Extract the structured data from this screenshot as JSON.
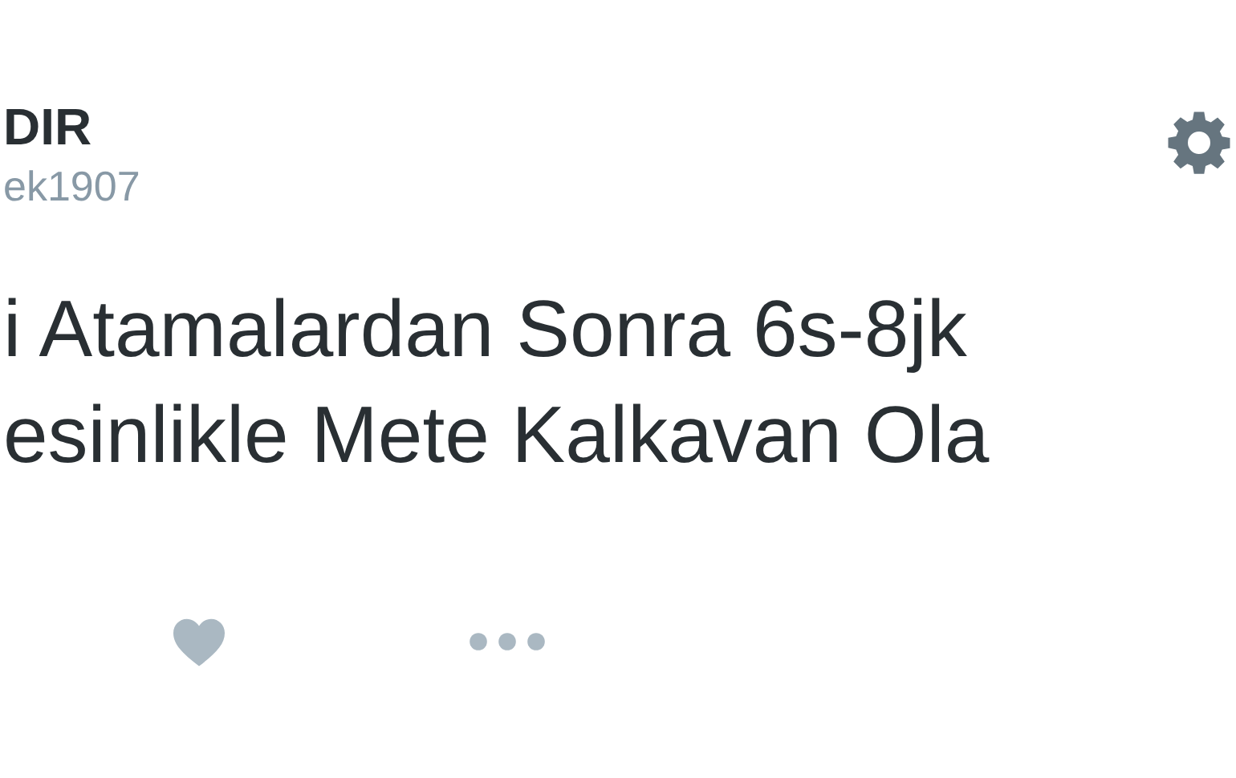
{
  "author": {
    "name": "DIR",
    "handle": "ek1907"
  },
  "tweet": {
    "lines": [
      "i Atamalardan Sonra 6s-8jk",
      "esinlikle Mete Kalkavan Ola"
    ]
  },
  "actions": [
    {
      "kind": "like"
    },
    {
      "kind": "more"
    }
  ]
}
